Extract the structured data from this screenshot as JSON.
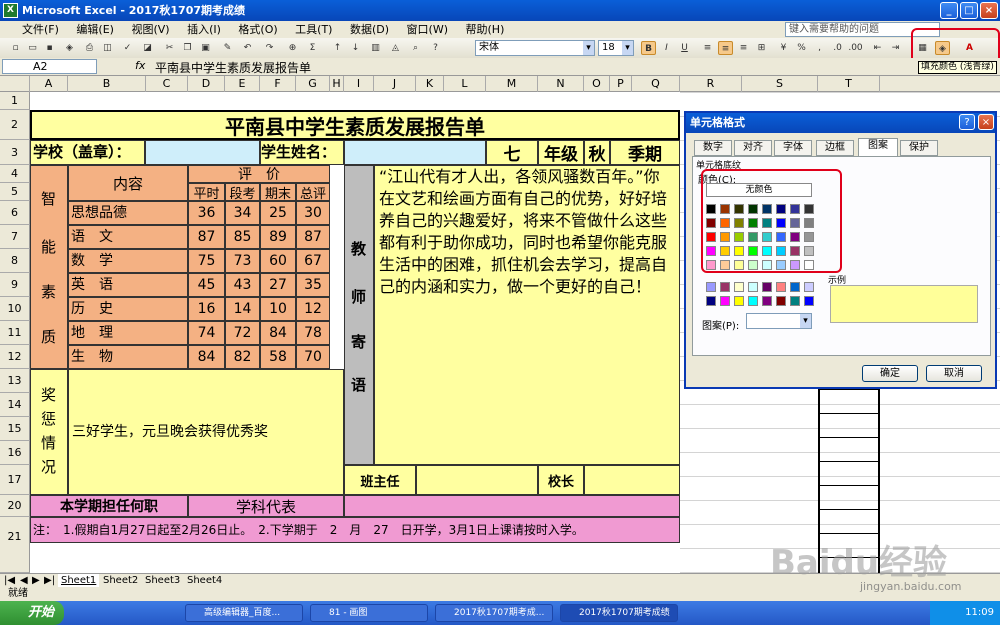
{
  "window": {
    "title": "Microsoft Excel - 2017秋1707期考成绩"
  },
  "menu": [
    "文件(F)",
    "编辑(E)",
    "视图(V)",
    "插入(I)",
    "格式(O)",
    "工具(T)",
    "数据(D)",
    "窗口(W)",
    "帮助(H)"
  ],
  "help_placeholder": "键入需要帮助的问题",
  "toolbar": {
    "font": "宋体",
    "size": "18",
    "bold": "B",
    "italic": "I",
    "underline": "U",
    "tooltip": "填充颜色 (浅青绿)"
  },
  "formula": {
    "namebox": "A2",
    "fx": "fx",
    "value": "平南县中学生素质发展报告单"
  },
  "columns": [
    "A",
    "B",
    "C",
    "D",
    "E",
    "F",
    "G",
    "H",
    "I",
    "J",
    "K",
    "L",
    "M",
    "N",
    "O",
    "P",
    "Q",
    "R",
    "S",
    "T"
  ],
  "rows": [
    "1",
    "2",
    "3",
    "4",
    "5",
    "6",
    "7",
    "8",
    "9",
    "10",
    "11",
    "12",
    "13",
    "14",
    "15",
    "16",
    "17",
    "20",
    "21"
  ],
  "sheet": {
    "title": "平南县中学生素质发展报告单",
    "school": "学校（盖章）：",
    "student": "学生姓名：",
    "grade_num": "七",
    "grade": "年级",
    "term1": "秋",
    "term2": "季期",
    "content": "内容",
    "eval": "评　价",
    "eval_cols": [
      "平时",
      "段考",
      "期末",
      "总评"
    ],
    "zhineng": [
      "智",
      "能",
      "素",
      "质"
    ],
    "subjects": [
      {
        "name": "思想品德",
        "v": [
          "36",
          "34",
          "25",
          "30"
        ]
      },
      {
        "name": "语　文",
        "v": [
          "87",
          "85",
          "89",
          "87"
        ]
      },
      {
        "name": "数　学",
        "v": [
          "75",
          "73",
          "60",
          "67"
        ]
      },
      {
        "name": "英　语",
        "v": [
          "45",
          "43",
          "27",
          "35"
        ]
      },
      {
        "name": "历　史",
        "v": [
          "16",
          "14",
          "10",
          "12"
        ]
      },
      {
        "name": "地　理",
        "v": [
          "74",
          "72",
          "84",
          "78"
        ]
      },
      {
        "name": "生　物",
        "v": [
          "84",
          "82",
          "58",
          "70"
        ]
      }
    ],
    "jiangcheng": [
      "奖",
      "惩",
      "情",
      "况"
    ],
    "award": "三好学生，元旦晚会获得优秀奖",
    "teacher_label": [
      "教",
      "师",
      "寄",
      "语"
    ],
    "comment": "“江山代有才人出，各领风骚数百年。”你在文艺和绘画方面有自己的优势，好好培养自己的兴趣爱好，将来不管做什么这些都有利于助你成功，同时也希望你能克服生活中的困难，抓住机会去学习，提高自己的内涵和实力，做一个更好的自己！",
    "banzhuren": "班主任",
    "xiaozhang": "校长",
    "duty_label": "本学期担任何职",
    "duty": "学科代表",
    "note": "注：　1.假期自1月27日起至2月26日止。　2.下学期于　2　月　27　日开学，3月1日上课请按时入学。"
  },
  "dialog": {
    "title": "单元格格式",
    "tabs": [
      "数字",
      "对齐",
      "字体",
      "边框",
      "图案",
      "保护"
    ],
    "section": "单元格底纹",
    "color_label": "颜色(C):",
    "no_color": "无颜色",
    "sample": "示例",
    "pattern_label": "图案(P):",
    "ok": "确定",
    "cancel": "取消",
    "palette": [
      [
        "#000000",
        "#993300",
        "#333300",
        "#003300",
        "#003366",
        "#000080",
        "#333399",
        "#333333"
      ],
      [
        "#800000",
        "#ff6600",
        "#808000",
        "#008000",
        "#008080",
        "#0000ff",
        "#666699",
        "#808080"
      ],
      [
        "#ff0000",
        "#ff9900",
        "#99cc00",
        "#339966",
        "#33cccc",
        "#3366ff",
        "#800080",
        "#969696"
      ],
      [
        "#ff00ff",
        "#ffcc00",
        "#ffff00",
        "#00ff00",
        "#00ffff",
        "#00ccff",
        "#993366",
        "#c0c0c0"
      ],
      [
        "#ff99cc",
        "#ffcc99",
        "#ffff99",
        "#ccffcc",
        "#ccffff",
        "#99ccff",
        "#cc99ff",
        "#ffffff"
      ]
    ],
    "palette2": [
      [
        "#9999ff",
        "#993366",
        "#ffffcc",
        "#ccffff",
        "#660066",
        "#ff8080",
        "#0066cc",
        "#ccccff"
      ],
      [
        "#000080",
        "#ff00ff",
        "#ffff00",
        "#00ffff",
        "#800080",
        "#800000",
        "#008080",
        "#0000ff"
      ]
    ],
    "sample_color": "#ffff99"
  },
  "sheet_tabs": [
    "Sheet1",
    "Sheet2",
    "Sheet3",
    "Sheet4"
  ],
  "status": "就绪",
  "taskbar": {
    "start": "开始",
    "tasks": [
      "高级编辑器_百度...",
      "81 - 画图",
      "2017秋1707期考成...",
      "2017秋1707期考成绩"
    ],
    "time": "11:09"
  },
  "watermark": "Baidu经验",
  "watermark_url": "jingyan.baidu.com"
}
